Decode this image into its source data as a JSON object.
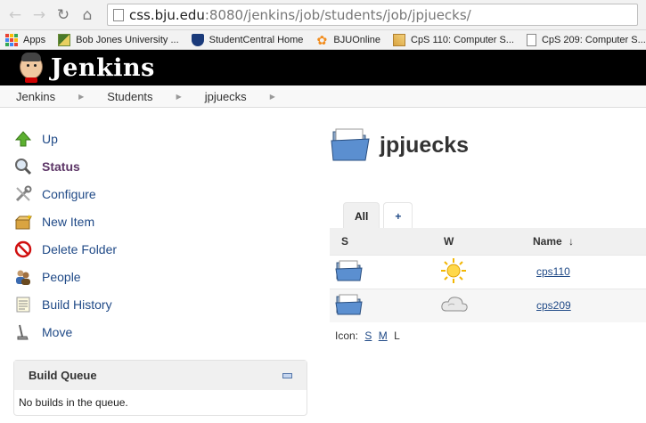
{
  "browser": {
    "url_host": "css.bju.edu",
    "url_path": ":8080/jenkins/job/students/job/jpjuecks/",
    "bookmarks": [
      {
        "label": "Apps",
        "icon": "apps-grid-icon"
      },
      {
        "label": "Bob Jones University ...",
        "icon": "bju-icon"
      },
      {
        "label": "StudentCentral Home",
        "icon": "shield-icon"
      },
      {
        "label": "BJUOnline",
        "icon": "flower-icon"
      },
      {
        "label": "CpS 110: Computer S...",
        "icon": "cps-icon"
      },
      {
        "label": "CpS 209: Computer S...",
        "icon": "page-icon"
      }
    ]
  },
  "header": {
    "title": "Jenkins"
  },
  "breadcrumb": [
    "Jenkins",
    "Students",
    "jpjuecks"
  ],
  "tasks": [
    {
      "label": "Up",
      "icon": "up-arrow-icon"
    },
    {
      "label": "Status",
      "icon": "magnifier-icon"
    },
    {
      "label": "Configure",
      "icon": "wrench-icon"
    },
    {
      "label": "New Item",
      "icon": "new-package-icon"
    },
    {
      "label": "Delete Folder",
      "icon": "no-entry-icon"
    },
    {
      "label": "People",
      "icon": "people-icon"
    },
    {
      "label": "Build History",
      "icon": "notepad-icon"
    },
    {
      "label": "Move",
      "icon": "move-icon"
    }
  ],
  "build_queue": {
    "title": "Build Queue",
    "empty_text": "No builds in the queue."
  },
  "main": {
    "title": "jpjuecks",
    "tabs": {
      "all": "All",
      "add": "+"
    },
    "columns": {
      "s": "S",
      "w": "W",
      "name": "Name",
      "sort_indicator": "↓"
    },
    "jobs": [
      {
        "name": "cps110",
        "status_icon": "folder-icon",
        "weather_icon": "sunny-icon"
      },
      {
        "name": "cps209",
        "status_icon": "folder-icon",
        "weather_icon": "cloudy-icon"
      }
    ],
    "icon_size": {
      "label": "Icon:",
      "small": "S",
      "medium": "M",
      "large": "L"
    }
  }
}
